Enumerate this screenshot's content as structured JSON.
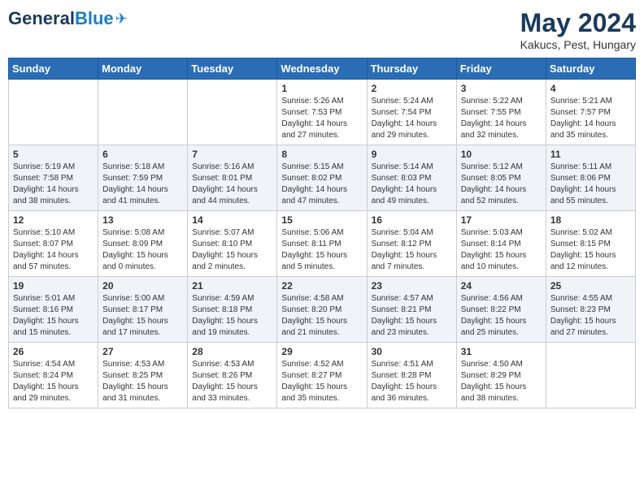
{
  "header": {
    "logo_general": "General",
    "logo_blue": "Blue",
    "month_title": "May 2024",
    "location": "Kakucs, Pest, Hungary"
  },
  "days_of_week": [
    "Sunday",
    "Monday",
    "Tuesday",
    "Wednesday",
    "Thursday",
    "Friday",
    "Saturday"
  ],
  "weeks": [
    [
      {
        "day": "",
        "sunrise": "",
        "sunset": "",
        "daylight": ""
      },
      {
        "day": "",
        "sunrise": "",
        "sunset": "",
        "daylight": ""
      },
      {
        "day": "",
        "sunrise": "",
        "sunset": "",
        "daylight": ""
      },
      {
        "day": "1",
        "sunrise": "Sunrise: 5:26 AM",
        "sunset": "Sunset: 7:53 PM",
        "daylight": "Daylight: 14 hours and 27 minutes."
      },
      {
        "day": "2",
        "sunrise": "Sunrise: 5:24 AM",
        "sunset": "Sunset: 7:54 PM",
        "daylight": "Daylight: 14 hours and 29 minutes."
      },
      {
        "day": "3",
        "sunrise": "Sunrise: 5:22 AM",
        "sunset": "Sunset: 7:55 PM",
        "daylight": "Daylight: 14 hours and 32 minutes."
      },
      {
        "day": "4",
        "sunrise": "Sunrise: 5:21 AM",
        "sunset": "Sunset: 7:57 PM",
        "daylight": "Daylight: 14 hours and 35 minutes."
      }
    ],
    [
      {
        "day": "5",
        "sunrise": "Sunrise: 5:19 AM",
        "sunset": "Sunset: 7:58 PM",
        "daylight": "Daylight: 14 hours and 38 minutes."
      },
      {
        "day": "6",
        "sunrise": "Sunrise: 5:18 AM",
        "sunset": "Sunset: 7:59 PM",
        "daylight": "Daylight: 14 hours and 41 minutes."
      },
      {
        "day": "7",
        "sunrise": "Sunrise: 5:16 AM",
        "sunset": "Sunset: 8:01 PM",
        "daylight": "Daylight: 14 hours and 44 minutes."
      },
      {
        "day": "8",
        "sunrise": "Sunrise: 5:15 AM",
        "sunset": "Sunset: 8:02 PM",
        "daylight": "Daylight: 14 hours and 47 minutes."
      },
      {
        "day": "9",
        "sunrise": "Sunrise: 5:14 AM",
        "sunset": "Sunset: 8:03 PM",
        "daylight": "Daylight: 14 hours and 49 minutes."
      },
      {
        "day": "10",
        "sunrise": "Sunrise: 5:12 AM",
        "sunset": "Sunset: 8:05 PM",
        "daylight": "Daylight: 14 hours and 52 minutes."
      },
      {
        "day": "11",
        "sunrise": "Sunrise: 5:11 AM",
        "sunset": "Sunset: 8:06 PM",
        "daylight": "Daylight: 14 hours and 55 minutes."
      }
    ],
    [
      {
        "day": "12",
        "sunrise": "Sunrise: 5:10 AM",
        "sunset": "Sunset: 8:07 PM",
        "daylight": "Daylight: 14 hours and 57 minutes."
      },
      {
        "day": "13",
        "sunrise": "Sunrise: 5:08 AM",
        "sunset": "Sunset: 8:09 PM",
        "daylight": "Daylight: 15 hours and 0 minutes."
      },
      {
        "day": "14",
        "sunrise": "Sunrise: 5:07 AM",
        "sunset": "Sunset: 8:10 PM",
        "daylight": "Daylight: 15 hours and 2 minutes."
      },
      {
        "day": "15",
        "sunrise": "Sunrise: 5:06 AM",
        "sunset": "Sunset: 8:11 PM",
        "daylight": "Daylight: 15 hours and 5 minutes."
      },
      {
        "day": "16",
        "sunrise": "Sunrise: 5:04 AM",
        "sunset": "Sunset: 8:12 PM",
        "daylight": "Daylight: 15 hours and 7 minutes."
      },
      {
        "day": "17",
        "sunrise": "Sunrise: 5:03 AM",
        "sunset": "Sunset: 8:14 PM",
        "daylight": "Daylight: 15 hours and 10 minutes."
      },
      {
        "day": "18",
        "sunrise": "Sunrise: 5:02 AM",
        "sunset": "Sunset: 8:15 PM",
        "daylight": "Daylight: 15 hours and 12 minutes."
      }
    ],
    [
      {
        "day": "19",
        "sunrise": "Sunrise: 5:01 AM",
        "sunset": "Sunset: 8:16 PM",
        "daylight": "Daylight: 15 hours and 15 minutes."
      },
      {
        "day": "20",
        "sunrise": "Sunrise: 5:00 AM",
        "sunset": "Sunset: 8:17 PM",
        "daylight": "Daylight: 15 hours and 17 minutes."
      },
      {
        "day": "21",
        "sunrise": "Sunrise: 4:59 AM",
        "sunset": "Sunset: 8:18 PM",
        "daylight": "Daylight: 15 hours and 19 minutes."
      },
      {
        "day": "22",
        "sunrise": "Sunrise: 4:58 AM",
        "sunset": "Sunset: 8:20 PM",
        "daylight": "Daylight: 15 hours and 21 minutes."
      },
      {
        "day": "23",
        "sunrise": "Sunrise: 4:57 AM",
        "sunset": "Sunset: 8:21 PM",
        "daylight": "Daylight: 15 hours and 23 minutes."
      },
      {
        "day": "24",
        "sunrise": "Sunrise: 4:56 AM",
        "sunset": "Sunset: 8:22 PM",
        "daylight": "Daylight: 15 hours and 25 minutes."
      },
      {
        "day": "25",
        "sunrise": "Sunrise: 4:55 AM",
        "sunset": "Sunset: 8:23 PM",
        "daylight": "Daylight: 15 hours and 27 minutes."
      }
    ],
    [
      {
        "day": "26",
        "sunrise": "Sunrise: 4:54 AM",
        "sunset": "Sunset: 8:24 PM",
        "daylight": "Daylight: 15 hours and 29 minutes."
      },
      {
        "day": "27",
        "sunrise": "Sunrise: 4:53 AM",
        "sunset": "Sunset: 8:25 PM",
        "daylight": "Daylight: 15 hours and 31 minutes."
      },
      {
        "day": "28",
        "sunrise": "Sunrise: 4:53 AM",
        "sunset": "Sunset: 8:26 PM",
        "daylight": "Daylight: 15 hours and 33 minutes."
      },
      {
        "day": "29",
        "sunrise": "Sunrise: 4:52 AM",
        "sunset": "Sunset: 8:27 PM",
        "daylight": "Daylight: 15 hours and 35 minutes."
      },
      {
        "day": "30",
        "sunrise": "Sunrise: 4:51 AM",
        "sunset": "Sunset: 8:28 PM",
        "daylight": "Daylight: 15 hours and 36 minutes."
      },
      {
        "day": "31",
        "sunrise": "Sunrise: 4:50 AM",
        "sunset": "Sunset: 8:29 PM",
        "daylight": "Daylight: 15 hours and 38 minutes."
      },
      {
        "day": "",
        "sunrise": "",
        "sunset": "",
        "daylight": ""
      }
    ]
  ]
}
